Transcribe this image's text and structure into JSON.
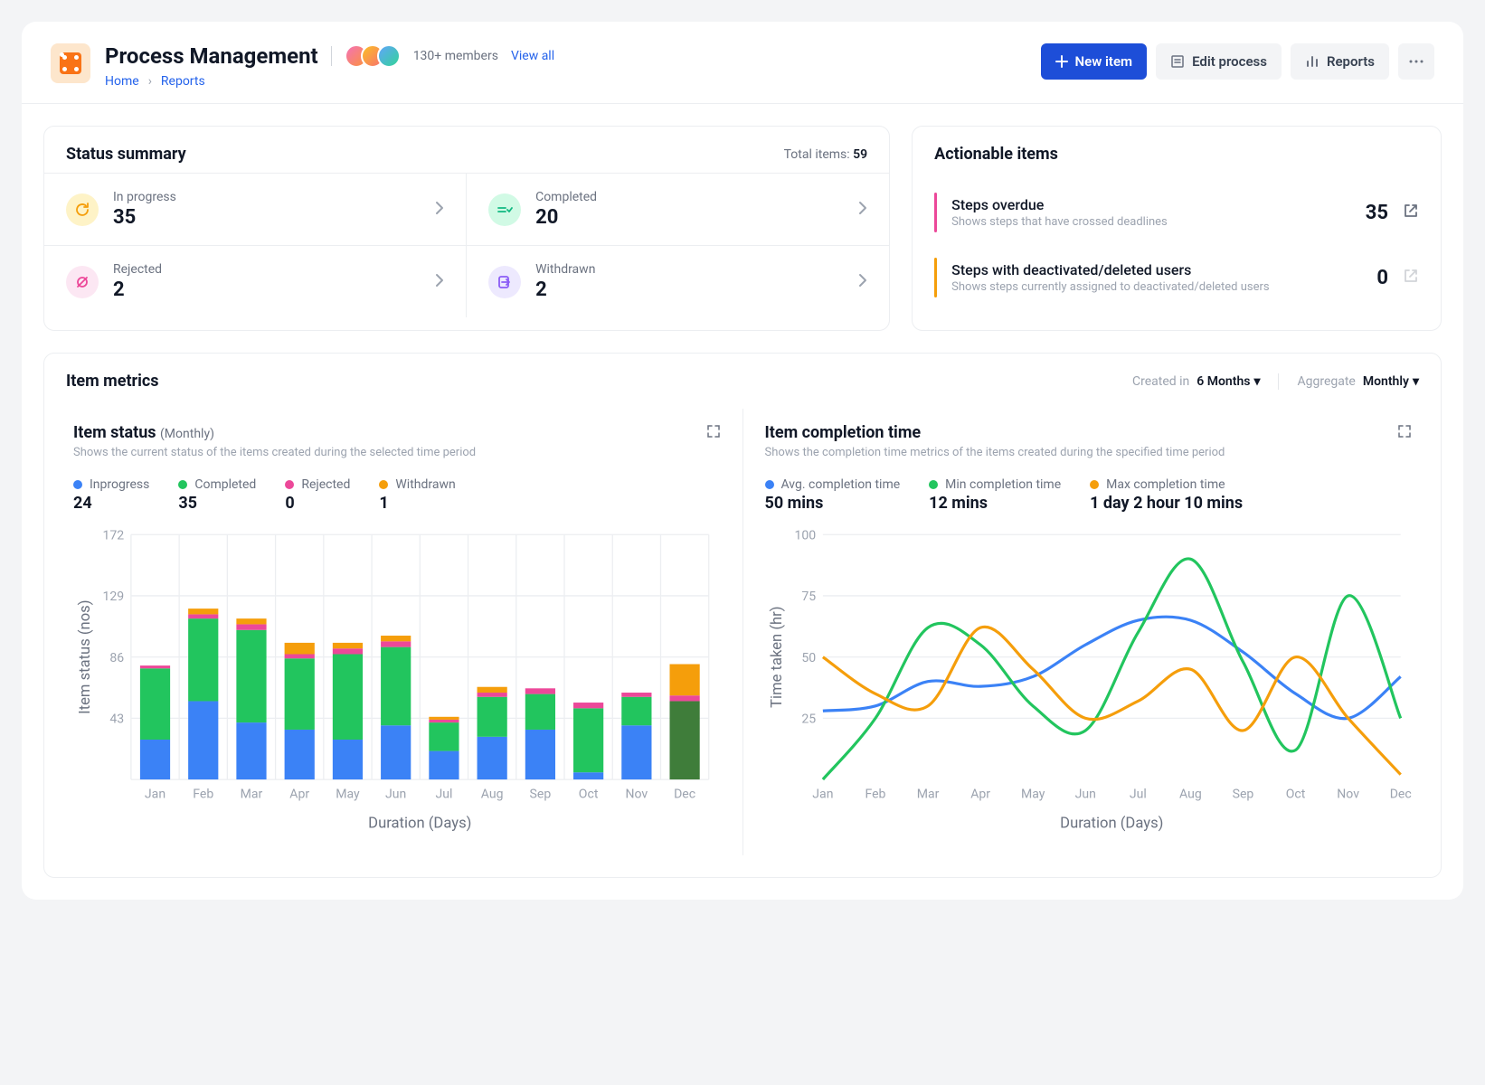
{
  "header": {
    "title": "Process Management",
    "members_text": "130+ members",
    "view_all": "View all",
    "breadcrumbs": [
      "Home",
      "Reports"
    ],
    "actions": {
      "new_item": "New item",
      "edit_process": "Edit process",
      "reports": "Reports"
    }
  },
  "status_summary": {
    "title": "Status summary",
    "total_label": "Total items:",
    "total_value": "59",
    "items": [
      {
        "label": "In progress",
        "value": "35",
        "icon": "refresh",
        "bg": "#fef3c7",
        "fg": "#f59e0b"
      },
      {
        "label": "Completed",
        "value": "20",
        "icon": "check",
        "bg": "#d1fae5",
        "fg": "#10b981"
      },
      {
        "label": "Rejected",
        "value": "2",
        "icon": "eye-off",
        "bg": "#fce7f3",
        "fg": "#ec4899"
      },
      {
        "label": "Withdrawn",
        "value": "2",
        "icon": "exit",
        "bg": "#ede9fe",
        "fg": "#8b5cf6"
      }
    ]
  },
  "actionable": {
    "title": "Actionable items",
    "items": [
      {
        "title": "Steps overdue",
        "sub": "Shows steps that have crossed deadlines",
        "count": "35",
        "bar": "#ec4899",
        "enabled": true
      },
      {
        "title": "Steps with deactivated/deleted users",
        "sub": "Shows steps currently assigned to deactivated/deleted users",
        "count": "0",
        "bar": "#f59e0b",
        "enabled": false
      }
    ]
  },
  "metrics": {
    "title": "Item metrics",
    "filters": {
      "created_label": "Created in",
      "created_value": "6 Months",
      "aggregate_label": "Aggregate",
      "aggregate_value": "Monthly"
    }
  },
  "item_status_chart": {
    "title": "Item status",
    "period": "(Monthly)",
    "desc": "Shows the current status of the items created during the selected time period",
    "legend": [
      {
        "label": "Inprogress",
        "value": "24",
        "color": "#3b82f6"
      },
      {
        "label": "Completed",
        "value": "35",
        "color": "#22c55e"
      },
      {
        "label": "Rejected",
        "value": "0",
        "color": "#ec4899"
      },
      {
        "label": "Withdrawn",
        "value": "1",
        "color": "#f59e0b"
      }
    ],
    "ylabel": "Item status (nos)",
    "xlabel": "Duration (Days)"
  },
  "completion_chart": {
    "title": "Item completion time",
    "desc": "Shows the completion time metrics of the items created during the specified time period",
    "legend": [
      {
        "label": "Avg. completion time",
        "value": "50 mins",
        "color": "#3b82f6"
      },
      {
        "label": "Min completion time",
        "value": "12 mins",
        "color": "#22c55e"
      },
      {
        "label": "Max completion time",
        "value": "1 day 2 hour 10 mins",
        "color": "#f59e0b"
      }
    ],
    "ylabel": "Time taken (hr)",
    "xlabel": "Duration (Days)"
  },
  "chart_data": [
    {
      "type": "bar",
      "title": "Item status (Monthly)",
      "xlabel": "Duration (Days)",
      "ylabel": "Item status (nos)",
      "ylim": [
        0,
        172
      ],
      "yticks": [
        43,
        86,
        129,
        172
      ],
      "categories": [
        "Jan",
        "Feb",
        "Mar",
        "Apr",
        "May",
        "Jun",
        "Jul",
        "Aug",
        "Sep",
        "Oct",
        "Nov",
        "Dec"
      ],
      "series": [
        {
          "name": "Inprogress",
          "color": "#3b82f6",
          "values": [
            28,
            55,
            40,
            35,
            28,
            38,
            20,
            30,
            35,
            5,
            38,
            0
          ]
        },
        {
          "name": "Completed",
          "color": "#22c55e",
          "values": [
            50,
            58,
            65,
            50,
            60,
            55,
            20,
            28,
            25,
            45,
            20,
            55
          ]
        },
        {
          "name": "Rejected",
          "color": "#ec4899",
          "values": [
            2,
            3,
            4,
            3,
            4,
            4,
            2,
            3,
            4,
            4,
            3,
            4
          ]
        },
        {
          "name": "Withdrawn",
          "color": "#f59e0b",
          "values": [
            0,
            4,
            4,
            8,
            4,
            4,
            2,
            4,
            0,
            0,
            0,
            22
          ]
        }
      ]
    },
    {
      "type": "line",
      "title": "Item completion time",
      "xlabel": "Duration (Days)",
      "ylabel": "Time taken (hr)",
      "ylim": [
        0,
        100
      ],
      "yticks": [
        25,
        50,
        75,
        100
      ],
      "categories": [
        "Jan",
        "Feb",
        "Mar",
        "Apr",
        "May",
        "Jun",
        "Jul",
        "Aug",
        "Sep",
        "Oct",
        "Nov",
        "Dec"
      ],
      "series": [
        {
          "name": "Avg. completion time",
          "color": "#3b82f6",
          "values": [
            28,
            30,
            40,
            38,
            42,
            55,
            65,
            65,
            52,
            35,
            25,
            42
          ]
        },
        {
          "name": "Min completion time",
          "color": "#22c55e",
          "values": [
            0,
            25,
            62,
            55,
            30,
            20,
            60,
            90,
            48,
            12,
            75,
            25
          ]
        },
        {
          "name": "Max completion time",
          "color": "#f59e0b",
          "values": [
            50,
            35,
            30,
            62,
            45,
            25,
            32,
            45,
            20,
            50,
            25,
            2
          ]
        }
      ]
    }
  ]
}
